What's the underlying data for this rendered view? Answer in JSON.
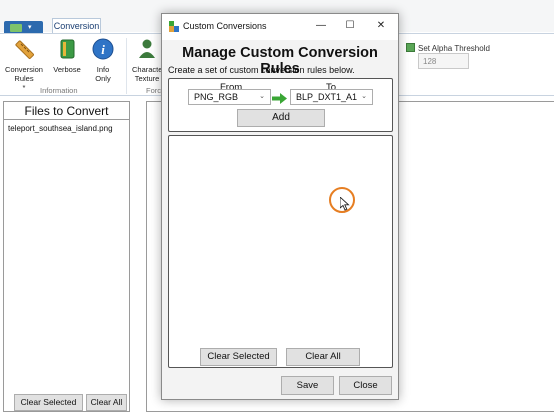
{
  "main_window": {
    "ribbon_tab": "Conversion",
    "buttons": [
      {
        "label": "Conversion Rules",
        "suffix": "*",
        "icon": "ruler-icon"
      },
      {
        "label": "Verbose",
        "icon": "book-icon"
      },
      {
        "label": "Info Only",
        "icon": "info-icon"
      },
      {
        "label": "Characte",
        "icon": "person-icon"
      }
    ],
    "texture_label": "Texture",
    "group_information": "Information",
    "group_force": "Forc",
    "threshold": {
      "label": "Set Alpha Threshold",
      "value": "128",
      "checked": true
    },
    "files_panel": {
      "title": "Files to Convert",
      "files": [
        "teleport_southsea_island.png"
      ],
      "clear_selected": "Clear Selected",
      "clear_all": "Clear All"
    }
  },
  "dialog": {
    "title": "Custom Conversions",
    "heading": "Manage Custom Conversion Rules",
    "description": "Create a set of custom conversion rules below.",
    "from_label": "From",
    "to_label": "To",
    "from_value": "PNG_RGB",
    "to_value": "BLP_DXT1_A1",
    "add_label": "Add",
    "clear_selected_label": "Clear Selected",
    "clear_all_label": "Clear All",
    "save_label": "Save",
    "close_label": "Close",
    "window_buttons": {
      "minimize": "—",
      "maximize": "☐",
      "close": "✕"
    }
  },
  "colors": {
    "accent": "#2c6aae",
    "arrow": "#3aa635",
    "cursor_ring": "#e67e22"
  }
}
